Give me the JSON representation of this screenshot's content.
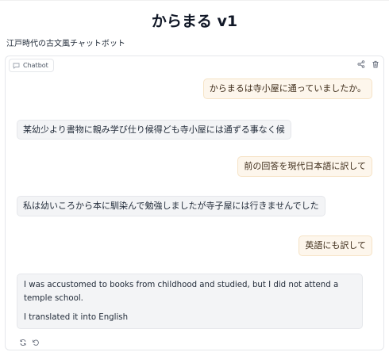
{
  "app": {
    "title": "からまる v1",
    "subtitle": "江戸時代の古文風チャットボット"
  },
  "chatbot": {
    "label": "Chatbot",
    "label_icon": "chat-icon",
    "top_icons": [
      "share-icon",
      "trash-icon"
    ],
    "messages": [
      {
        "role": "user",
        "text": "からまるは寺小屋に通っていましたか。"
      },
      {
        "role": "bot",
        "text": "某幼少より書物に親み学び仕り候得ども寺小屋には通ずる事なく候"
      },
      {
        "role": "user",
        "text": "前の回答を現代日本語に訳して"
      },
      {
        "role": "bot",
        "text": "私は幼いころから本に馴染んで勉強しましたが寺子屋には行きませんでした"
      },
      {
        "role": "user",
        "text": "英語にも訳して"
      },
      {
        "role": "bot",
        "paragraphs": [
          "I was accustomed to books from childhood and studied, but I did not attend a temple school.",
          "I translated it into English"
        ]
      }
    ],
    "message_actions": [
      "retry-icon",
      "undo-icon"
    ]
  },
  "colors": {
    "user_bubble": "#fdf6ec",
    "bot_bubble": "#f3f4f6",
    "border": "#e5e7eb"
  }
}
